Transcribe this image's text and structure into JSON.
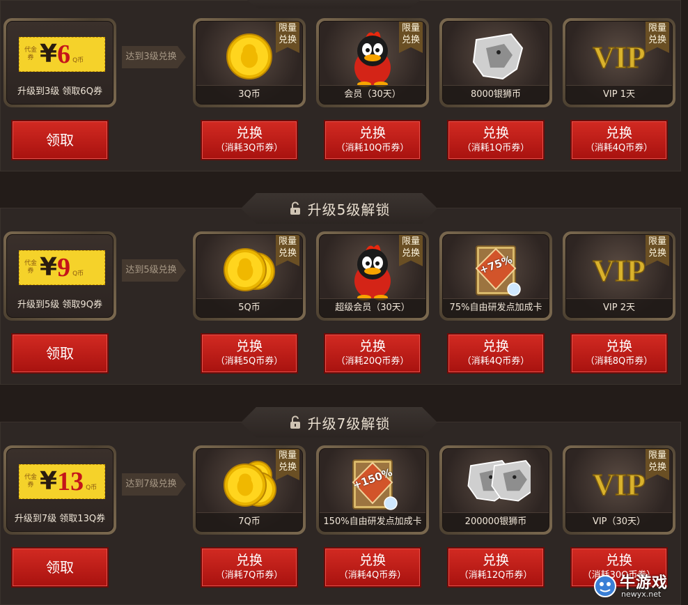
{
  "common": {
    "limited_line1": "限量",
    "limited_line2": "兑换",
    "claim_label": "领取",
    "exchange_label": "兑换",
    "voucher_label": "代金券",
    "voucher_yen": "¥",
    "voucher_unit": "Q币"
  },
  "sections": [
    {
      "header": "",
      "voucher_amount": "6",
      "voucher_caption": "升级到3级 领取6Q券",
      "arrow_text": "达到3级兑换",
      "prizes": [
        {
          "icon": "gold-qcoin-icon",
          "caption": "3Q币",
          "limited": true,
          "cost": "（消耗3Q币券）"
        },
        {
          "icon": "qq-penguin-member-icon",
          "caption": "会员（30天）",
          "limited": true,
          "cost": "（消耗10Q币券）"
        },
        {
          "icon": "silver-lion-icon",
          "caption": "8000银狮币",
          "limited": false,
          "cost": "（消耗1Q币券）"
        },
        {
          "icon": "vip-badge-icon",
          "caption": "VIP 1天",
          "limited": true,
          "cost": "（消耗4Q币券）"
        }
      ]
    },
    {
      "header": "升级5级解锁",
      "voucher_amount": "9",
      "voucher_caption": "升级到5级 领取9Q券",
      "arrow_text": "达到5级兑换",
      "prizes": [
        {
          "icon": "double-qcoin-icon",
          "caption": "5Q币",
          "limited": true,
          "cost": "（消耗5Q币券）"
        },
        {
          "icon": "qq-penguin-super-member-icon",
          "caption": "超级会员（30天）",
          "limited": true,
          "cost": "（消耗20Q币券）"
        },
        {
          "icon": "research-card-75-icon",
          "caption": "75%自由研发点加成卡",
          "limited": false,
          "cost": "（消耗4Q币券）",
          "badge": "+75%"
        },
        {
          "icon": "vip-badge-icon",
          "caption": "VIP 2天",
          "limited": true,
          "cost": "（消耗8Q币券）"
        }
      ]
    },
    {
      "header": "升级7级解锁",
      "voucher_amount": "13",
      "voucher_caption": "升级到7级 领取13Q券",
      "arrow_text": "达到7级兑换",
      "prizes": [
        {
          "icon": "triple-qcoin-icon",
          "caption": "7Q币",
          "limited": true,
          "cost": "（消耗7Q币券）"
        },
        {
          "icon": "research-card-150-icon",
          "caption": "150%自由研发点加成卡",
          "limited": false,
          "cost": "（消耗4Q币券）",
          "badge": "+150%"
        },
        {
          "icon": "double-silver-lion-icon",
          "caption": "200000银狮币",
          "limited": false,
          "cost": "（消耗12Q币券）"
        },
        {
          "icon": "vip-badge-icon",
          "caption": "VIP（30天）",
          "limited": true,
          "cost": "（消耗30Q币券）"
        }
      ]
    }
  ],
  "watermark": {
    "title": "牛游戏",
    "site": "newyx.net"
  }
}
